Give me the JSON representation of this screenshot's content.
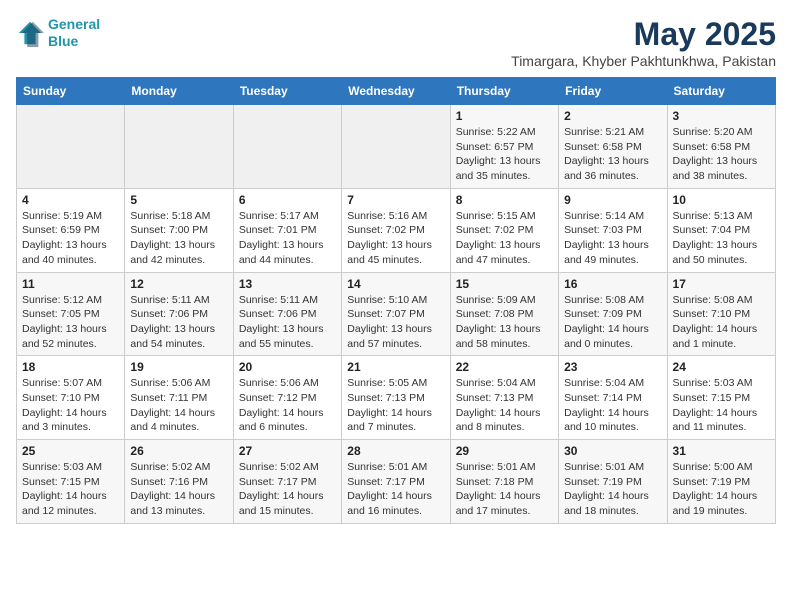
{
  "logo": {
    "line1": "General",
    "line2": "Blue"
  },
  "title": "May 2025",
  "location": "Timargara, Khyber Pakhtunkhwa, Pakistan",
  "days_of_week": [
    "Sunday",
    "Monday",
    "Tuesday",
    "Wednesday",
    "Thursday",
    "Friday",
    "Saturday"
  ],
  "weeks": [
    [
      {
        "day": "",
        "info": ""
      },
      {
        "day": "",
        "info": ""
      },
      {
        "day": "",
        "info": ""
      },
      {
        "day": "",
        "info": ""
      },
      {
        "day": "1",
        "info": "Sunrise: 5:22 AM\nSunset: 6:57 PM\nDaylight: 13 hours\nand 35 minutes."
      },
      {
        "day": "2",
        "info": "Sunrise: 5:21 AM\nSunset: 6:58 PM\nDaylight: 13 hours\nand 36 minutes."
      },
      {
        "day": "3",
        "info": "Sunrise: 5:20 AM\nSunset: 6:58 PM\nDaylight: 13 hours\nand 38 minutes."
      }
    ],
    [
      {
        "day": "4",
        "info": "Sunrise: 5:19 AM\nSunset: 6:59 PM\nDaylight: 13 hours\nand 40 minutes."
      },
      {
        "day": "5",
        "info": "Sunrise: 5:18 AM\nSunset: 7:00 PM\nDaylight: 13 hours\nand 42 minutes."
      },
      {
        "day": "6",
        "info": "Sunrise: 5:17 AM\nSunset: 7:01 PM\nDaylight: 13 hours\nand 44 minutes."
      },
      {
        "day": "7",
        "info": "Sunrise: 5:16 AM\nSunset: 7:02 PM\nDaylight: 13 hours\nand 45 minutes."
      },
      {
        "day": "8",
        "info": "Sunrise: 5:15 AM\nSunset: 7:02 PM\nDaylight: 13 hours\nand 47 minutes."
      },
      {
        "day": "9",
        "info": "Sunrise: 5:14 AM\nSunset: 7:03 PM\nDaylight: 13 hours\nand 49 minutes."
      },
      {
        "day": "10",
        "info": "Sunrise: 5:13 AM\nSunset: 7:04 PM\nDaylight: 13 hours\nand 50 minutes."
      }
    ],
    [
      {
        "day": "11",
        "info": "Sunrise: 5:12 AM\nSunset: 7:05 PM\nDaylight: 13 hours\nand 52 minutes."
      },
      {
        "day": "12",
        "info": "Sunrise: 5:11 AM\nSunset: 7:06 PM\nDaylight: 13 hours\nand 54 minutes."
      },
      {
        "day": "13",
        "info": "Sunrise: 5:11 AM\nSunset: 7:06 PM\nDaylight: 13 hours\nand 55 minutes."
      },
      {
        "day": "14",
        "info": "Sunrise: 5:10 AM\nSunset: 7:07 PM\nDaylight: 13 hours\nand 57 minutes."
      },
      {
        "day": "15",
        "info": "Sunrise: 5:09 AM\nSunset: 7:08 PM\nDaylight: 13 hours\nand 58 minutes."
      },
      {
        "day": "16",
        "info": "Sunrise: 5:08 AM\nSunset: 7:09 PM\nDaylight: 14 hours\nand 0 minutes."
      },
      {
        "day": "17",
        "info": "Sunrise: 5:08 AM\nSunset: 7:10 PM\nDaylight: 14 hours\nand 1 minute."
      }
    ],
    [
      {
        "day": "18",
        "info": "Sunrise: 5:07 AM\nSunset: 7:10 PM\nDaylight: 14 hours\nand 3 minutes."
      },
      {
        "day": "19",
        "info": "Sunrise: 5:06 AM\nSunset: 7:11 PM\nDaylight: 14 hours\nand 4 minutes."
      },
      {
        "day": "20",
        "info": "Sunrise: 5:06 AM\nSunset: 7:12 PM\nDaylight: 14 hours\nand 6 minutes."
      },
      {
        "day": "21",
        "info": "Sunrise: 5:05 AM\nSunset: 7:13 PM\nDaylight: 14 hours\nand 7 minutes."
      },
      {
        "day": "22",
        "info": "Sunrise: 5:04 AM\nSunset: 7:13 PM\nDaylight: 14 hours\nand 8 minutes."
      },
      {
        "day": "23",
        "info": "Sunrise: 5:04 AM\nSunset: 7:14 PM\nDaylight: 14 hours\nand 10 minutes."
      },
      {
        "day": "24",
        "info": "Sunrise: 5:03 AM\nSunset: 7:15 PM\nDaylight: 14 hours\nand 11 minutes."
      }
    ],
    [
      {
        "day": "25",
        "info": "Sunrise: 5:03 AM\nSunset: 7:15 PM\nDaylight: 14 hours\nand 12 minutes."
      },
      {
        "day": "26",
        "info": "Sunrise: 5:02 AM\nSunset: 7:16 PM\nDaylight: 14 hours\nand 13 minutes."
      },
      {
        "day": "27",
        "info": "Sunrise: 5:02 AM\nSunset: 7:17 PM\nDaylight: 14 hours\nand 15 minutes."
      },
      {
        "day": "28",
        "info": "Sunrise: 5:01 AM\nSunset: 7:17 PM\nDaylight: 14 hours\nand 16 minutes."
      },
      {
        "day": "29",
        "info": "Sunrise: 5:01 AM\nSunset: 7:18 PM\nDaylight: 14 hours\nand 17 minutes."
      },
      {
        "day": "30",
        "info": "Sunrise: 5:01 AM\nSunset: 7:19 PM\nDaylight: 14 hours\nand 18 minutes."
      },
      {
        "day": "31",
        "info": "Sunrise: 5:00 AM\nSunset: 7:19 PM\nDaylight: 14 hours\nand 19 minutes."
      }
    ]
  ]
}
